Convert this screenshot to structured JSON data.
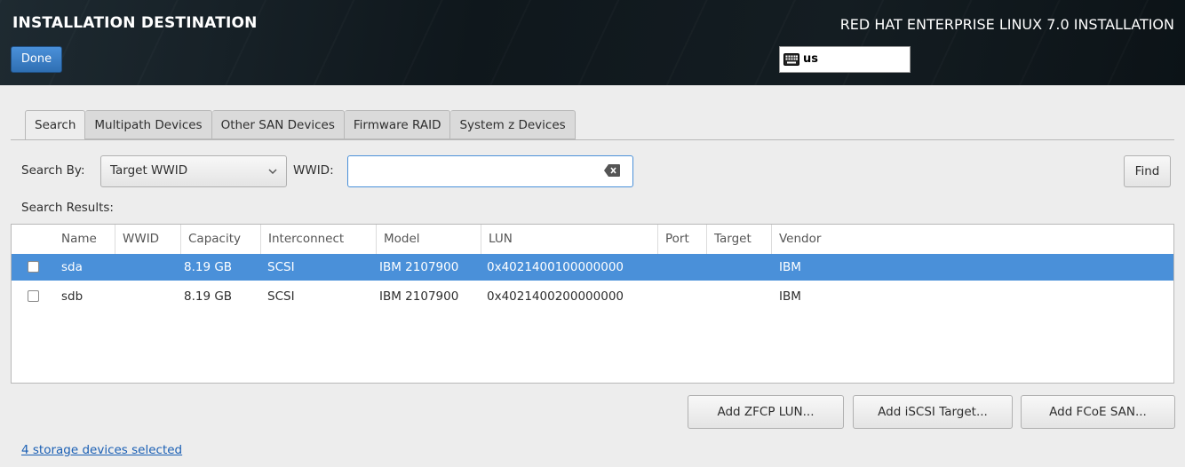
{
  "header": {
    "title": "INSTALLATION DESTINATION",
    "done_label": "Done",
    "product": "RED HAT ENTERPRISE LINUX 7.0 INSTALLATION",
    "keyboard_layout": "us",
    "keyboard_icon": "keyboard-icon"
  },
  "tabs": [
    {
      "label": "Search",
      "active": true
    },
    {
      "label": "Multipath Devices",
      "active": false
    },
    {
      "label": "Other SAN Devices",
      "active": false
    },
    {
      "label": "Firmware RAID",
      "active": false
    },
    {
      "label": "System z Devices",
      "active": false
    }
  ],
  "search": {
    "by_label": "Search By:",
    "by_value": "Target WWID",
    "wwid_label": "WWID:",
    "wwid_value": "",
    "find_label": "Find",
    "results_label": "Search Results:"
  },
  "table": {
    "columns": [
      "Name",
      "WWID",
      "Capacity",
      "Interconnect",
      "Model",
      "LUN",
      "Port",
      "Target",
      "Vendor"
    ],
    "rows": [
      {
        "checked": false,
        "selected": true,
        "name": "sda",
        "wwid": "",
        "capacity": "8.19 GB",
        "interconnect": "SCSI",
        "model": "IBM 2107900",
        "lun": "0x4021400100000000",
        "port": "",
        "target": "",
        "vendor": "IBM"
      },
      {
        "checked": false,
        "selected": false,
        "name": "sdb",
        "wwid": "",
        "capacity": "8.19 GB",
        "interconnect": "SCSI",
        "model": "IBM 2107900",
        "lun": "0x4021400200000000",
        "port": "",
        "target": "",
        "vendor": "IBM"
      }
    ]
  },
  "actions": {
    "add_zfcp": "Add ZFCP LUN...",
    "add_iscsi": "Add iSCSI Target...",
    "add_fcoe": "Add FCoE SAN..."
  },
  "status": {
    "selected_link": "4 storage devices selected"
  },
  "colors": {
    "accent": "#4a90d9",
    "header_bg": "#141d22",
    "link": "#1a5fb4"
  }
}
